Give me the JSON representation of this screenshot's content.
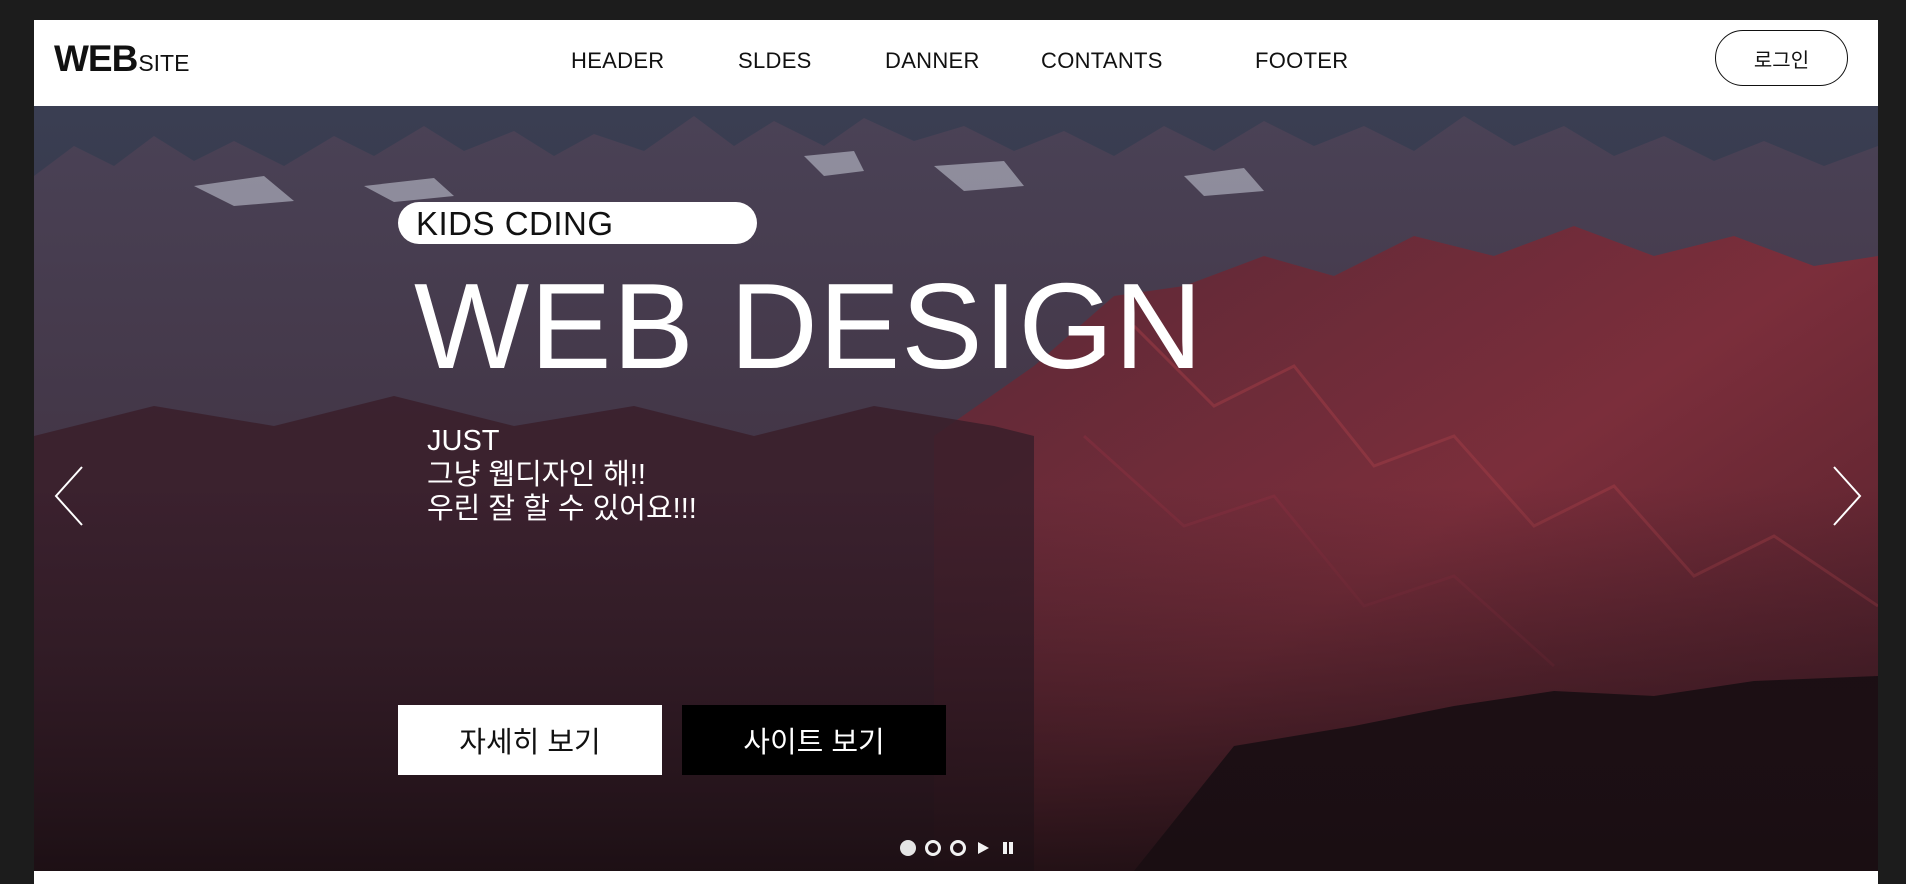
{
  "header": {
    "logo_main": "WEB",
    "logo_sub": "SITE",
    "nav": [
      "HEADER",
      "SLDES",
      "DANNER",
      "CONTANTS",
      "FOOTER"
    ],
    "login_label": "로그인"
  },
  "hero": {
    "badge": "KIDS CDING",
    "title": "WEB DESIGN",
    "desc": [
      "JUST",
      "그냥 웹디자인 해!!",
      "우린 잘 할 수 있어요!!!"
    ],
    "buttons": {
      "detail": "자세히 보기",
      "site": "사이트 보기"
    },
    "slides": {
      "count": 3,
      "active_index": 0
    },
    "icons": {
      "prev": "chevron-left-icon",
      "next": "chevron-right-icon",
      "play": "play-icon",
      "pause": "pause-icon"
    }
  },
  "colors": {
    "page_bg": "#1c1c1c",
    "header_bg": "#ffffff",
    "text_dark": "#111111",
    "hero_sky": "#2b2e3e",
    "mountain_red": "#7a2a35",
    "btn_dark": "#000000"
  }
}
